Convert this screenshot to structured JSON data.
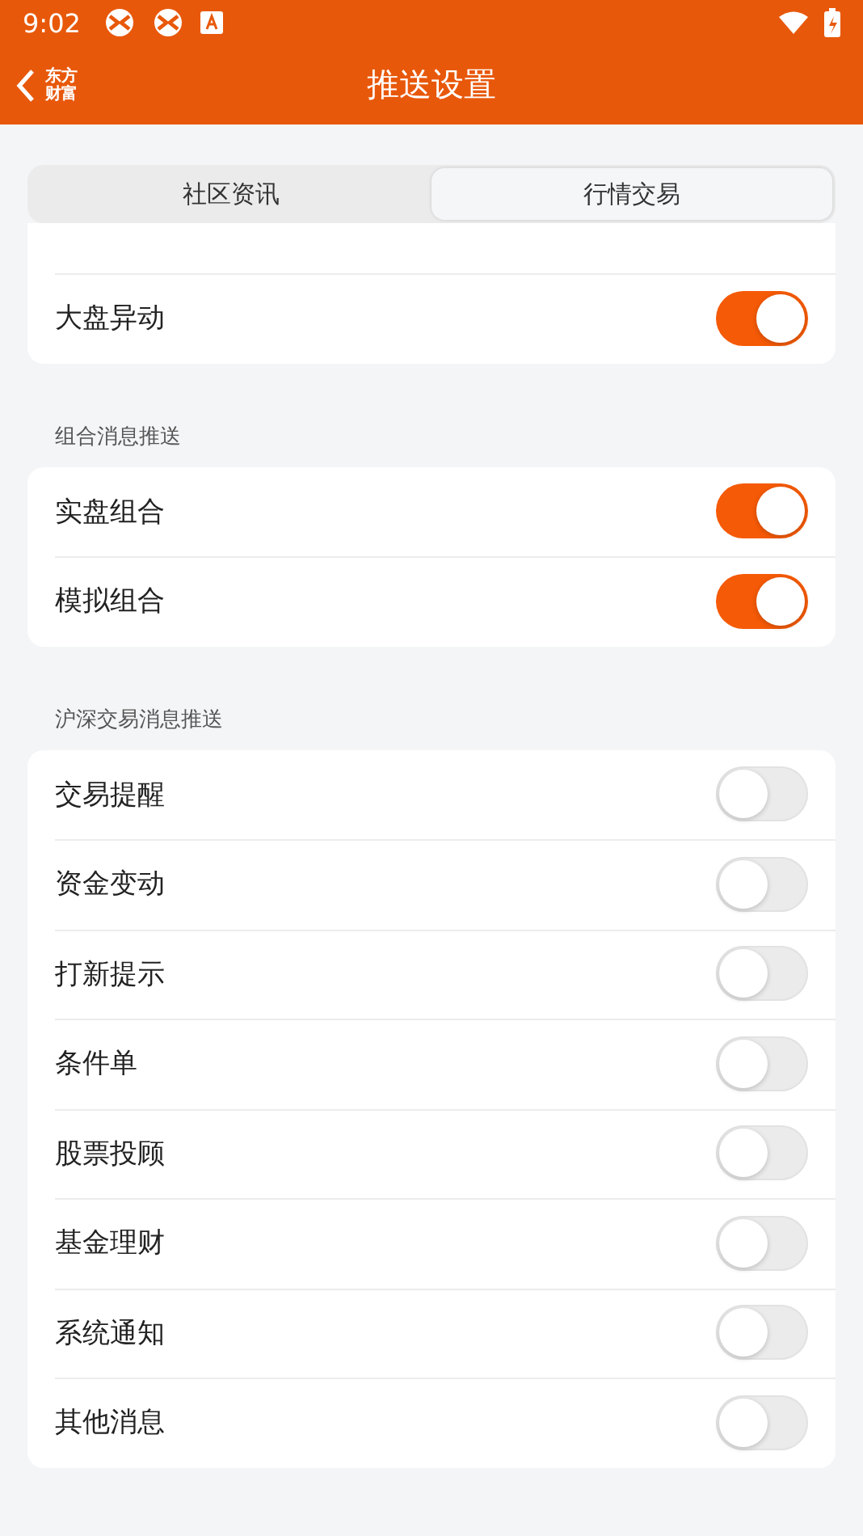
{
  "status_bar": {
    "time": "9:02"
  },
  "header": {
    "title": "推送设置",
    "logo": [
      "东方",
      "财富"
    ]
  },
  "tabs": [
    {
      "label": "社区资讯",
      "selected": false
    },
    {
      "label": "行情交易",
      "selected": true
    }
  ],
  "sections": [
    {
      "rows": [
        {
          "label": "大盘异动",
          "kind": "toggle",
          "on": true
        }
      ]
    },
    {
      "title": "组合消息推送",
      "rows": [
        {
          "label": "实盘组合",
          "kind": "toggle",
          "on": true
        },
        {
          "label": "模拟组合",
          "kind": "toggle",
          "on": true
        }
      ]
    },
    {
      "title": "沪深交易消息推送",
      "rows": [
        {
          "label": "交易提醒",
          "kind": "toggle",
          "on": false
        },
        {
          "label": "资金变动",
          "kind": "toggle",
          "on": false
        },
        {
          "label": "打新提示",
          "kind": "toggle",
          "on": false
        },
        {
          "label": "条件单",
          "kind": "toggle",
          "on": false
        },
        {
          "label": "股票投顾",
          "kind": "toggle",
          "on": false
        },
        {
          "label": "基金理财",
          "kind": "toggle",
          "on": false
        },
        {
          "label": "系统通知",
          "kind": "toggle",
          "on": false
        },
        {
          "label": "其他消息",
          "kind": "toggle",
          "on": false
        }
      ]
    }
  ]
}
